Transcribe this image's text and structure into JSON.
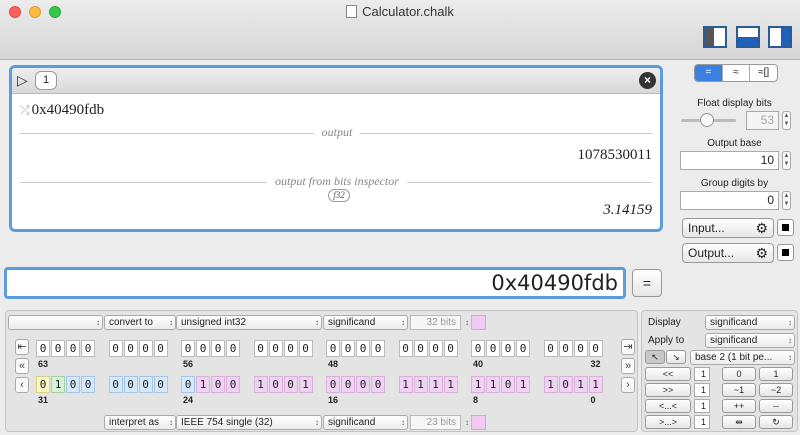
{
  "window": {
    "title": "Calculator.chalk"
  },
  "entry": {
    "index": "1",
    "input": "0x40490fdb",
    "output_label": "output",
    "output_value": "1078530011",
    "inspector_label": "output from bits inspector",
    "inspector_tag": "f32",
    "inspector_value": "3.14159"
  },
  "right_panel": {
    "modes": [
      "=",
      "≈",
      "≈[]"
    ],
    "float_bits_label": "Float display bits",
    "float_bits_value": "53",
    "output_base_label": "Output base",
    "output_base_value": "10",
    "group_digits_label": "Group digits by",
    "group_digits_value": "0",
    "input_button": "Input...",
    "output_button": "Output..."
  },
  "main_input": {
    "value": "0x40490fdb",
    "eval_label": "="
  },
  "bits": {
    "top_row": {
      "dd0": "",
      "convert_label": "convert to",
      "type": "unsigned int32",
      "part": "significand",
      "bits": "32 bits",
      "values": [
        "0",
        "0",
        "0",
        "0",
        "0",
        "0",
        "0",
        "0",
        "0",
        "0",
        "0",
        "0",
        "0",
        "0",
        "0",
        "0",
        "0",
        "0",
        "0",
        "0",
        "0",
        "0",
        "0",
        "0",
        "0",
        "0",
        "0",
        "0",
        "0",
        "0",
        "0",
        "0"
      ],
      "labels": [
        "63",
        "56",
        "48",
        "40",
        "32"
      ]
    },
    "bottom_row": {
      "interpret_label": "interpret as",
      "type": "IEEE 754 single (32)",
      "part": "significand",
      "bits": "23 bits",
      "values": [
        "0",
        "1",
        "0",
        "0",
        "0",
        "0",
        "0",
        "0",
        "0",
        "1",
        "0",
        "0",
        "1",
        "0",
        "0",
        "1",
        "0",
        "0",
        "0",
        "0",
        "1",
        "1",
        "1",
        "1",
        "1",
        "1",
        "0",
        "1",
        "1",
        "0",
        "1",
        "1"
      ],
      "labels": [
        "31",
        "24",
        "16",
        "8",
        "0"
      ]
    }
  },
  "display_panel": {
    "display_label": "Display",
    "display_value": "significand",
    "apply_label": "Apply to",
    "apply_value": "significand",
    "base_value": "base 2 (1 bit pe...",
    "shift_left": "<<",
    "shift_right": ">>",
    "rot_left": "<...<",
    "rot_right": ">...>",
    "n1": "1",
    "n2": "1",
    "n3": "1",
    "n4": "1",
    "zero": "0",
    "one": "1",
    "not1": "~1",
    "not2": "~2",
    "inc": "++",
    "dec": "--",
    "swap": "⇹",
    "reset": "↻"
  }
}
